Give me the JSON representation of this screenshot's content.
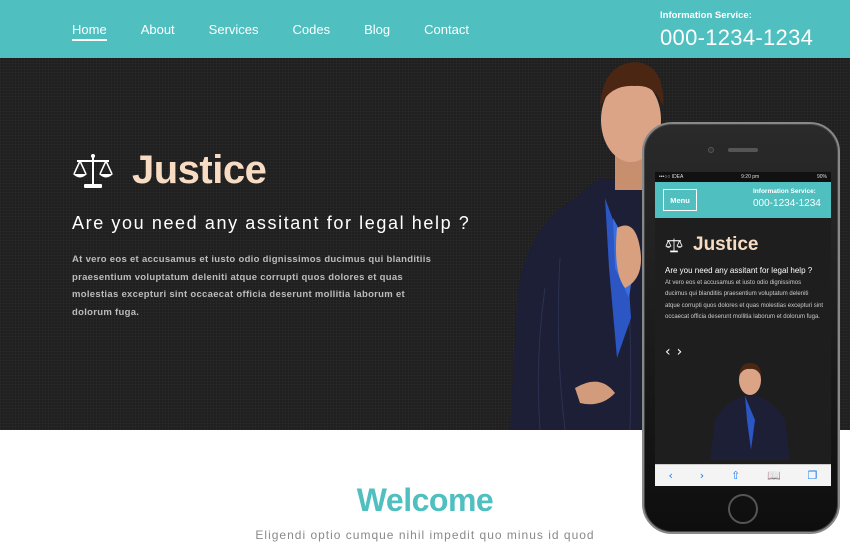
{
  "nav": {
    "items": [
      {
        "label": "Home",
        "active": true
      },
      {
        "label": "About",
        "active": false
      },
      {
        "label": "Services",
        "active": false
      },
      {
        "label": "Codes",
        "active": false
      },
      {
        "label": "Blog",
        "active": false
      },
      {
        "label": "Contact",
        "active": false
      }
    ]
  },
  "info": {
    "label": "Information Service:",
    "phone": "000-1234-1234"
  },
  "hero": {
    "title": "Justice",
    "subtitle": "Are you need any assitant for legal help ?",
    "text": "At vero eos et accusamus et iusto odio dignissimos ducimus qui blanditiis praesentium voluptatum deleniti atque corrupti quos dolores et quas molestias excepturi sint occaecat officia deserunt mollitia laborum et dolorum fuga."
  },
  "welcome": {
    "title": "Welcome",
    "subtitle": "Eligendi optio cumque nihil impedit quo minus id quod"
  },
  "mobile": {
    "status_left": "•••○○ IDEA",
    "status_time": "9:20 pm",
    "status_right": "90%",
    "menu_label": "Menu",
    "info_label": "Information Service:",
    "info_phone": "000-1234-1234",
    "title": "Justice",
    "subtitle": "Are you need any assitant for legal help ?",
    "text": "At vero eos et accusamus et iusto odio dignissimos ducimus qui blanditiis praesentium voluptatum deleniti atque corrupti quos dolores et quas molestias excepturi sint occaecat officia deserunt mollitia laborum et dolorum fuga.",
    "prev_arrow": "‹",
    "next_arrow": "›",
    "toolbar": {
      "back": "‹",
      "forward": "›",
      "share": "⇧",
      "bookmarks": "📖",
      "tabs": "❐"
    }
  },
  "colors": {
    "accent": "#4fbfc0",
    "hero_bg": "#1f1f1f",
    "title_peach": "#f7dcc3"
  },
  "icons": {
    "brand": "scales-of-justice-icon"
  }
}
